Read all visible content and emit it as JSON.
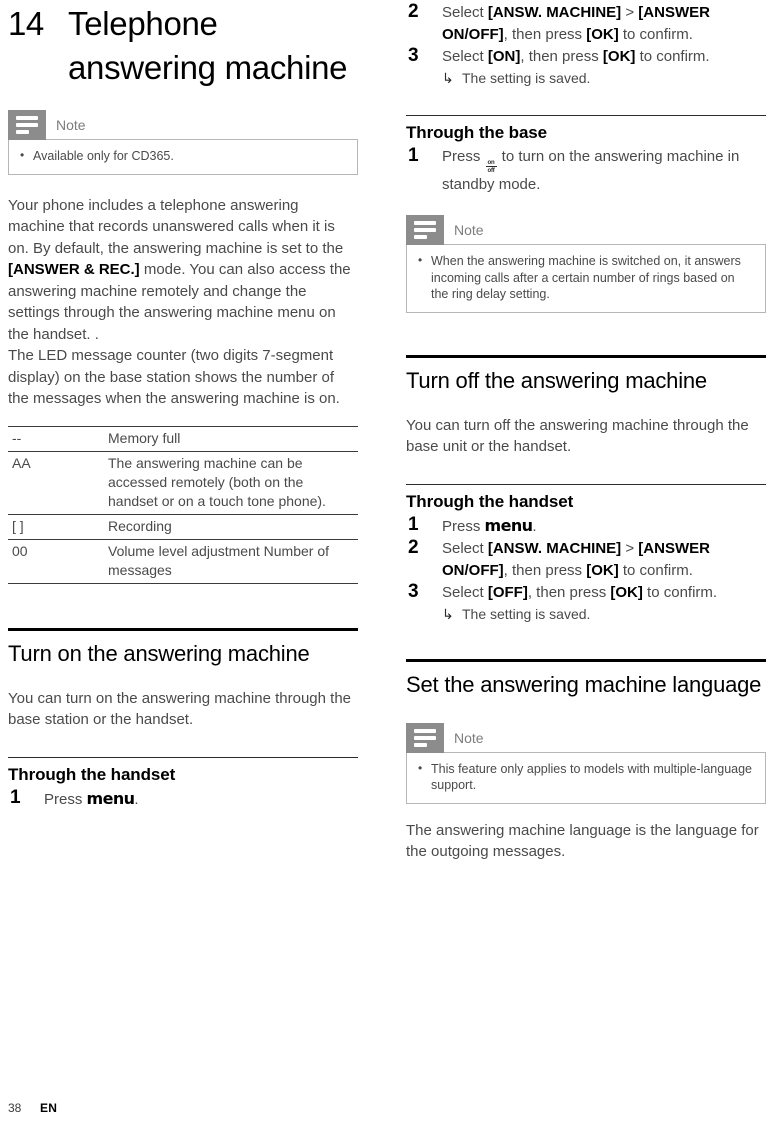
{
  "chapter": {
    "number": "14",
    "title": "Telephone answering machine"
  },
  "footer": {
    "page_number": "38",
    "language_code": "EN"
  },
  "icons": {
    "note_icon": "note-lines-icon",
    "onoff_top": "on",
    "onoff_bottom": "off",
    "substep_arrow": "↳"
  },
  "left_column": {
    "note_1": {
      "label": "Note",
      "items": [
        "Available only for CD365."
      ]
    },
    "intro_paragraphs": [
      "Your phone includes a telephone answering machine that records unanswered calls when it is on. By default, the answering machine is set to the",
      "[ANSWER & REC.] mode. You can also access the answering machine remotely and change the settings through the answering machine menu on the handset. .",
      "The LED message counter (two digits 7-segment display) on the base station shows the number of the messages when the answering machine is on."
    ],
    "intro_bold_run": "[ANSWER & REC.]",
    "intro_bold_tail": " mode. You can also access the answering machine remotely and change the settings through the answering machine menu on the handset. .",
    "table": {
      "rows": [
        {
          "code": "--",
          "description": "Memory full"
        },
        {
          "code": "AA",
          "description": "The answering machine can be accessed remotely (both on the handset or on a touch tone phone)."
        },
        {
          "code": "[ ]",
          "description": "Recording"
        },
        {
          "code": "00",
          "description": "Volume level adjustment Number of messages"
        }
      ]
    },
    "section_turn_on": {
      "heading": "Turn on the answering machine",
      "body": "You can turn on the answering machine through the base station or the handset.",
      "subsection": {
        "heading": "Through the handset",
        "steps": [
          {
            "num": "1",
            "text_before": "Press ",
            "key": "menu",
            "text_after": "."
          }
        ]
      }
    }
  },
  "right_column": {
    "continued_steps": [
      {
        "num": "2",
        "parts": [
          {
            "t": "Select ",
            "b": false
          },
          {
            "t": "[ANSW. MACHINE]",
            "b": true
          },
          {
            "t": " > ",
            "b": false
          },
          {
            "t": "[ANSWER ON/OFF]",
            "b": true
          },
          {
            "t": ", then press ",
            "b": false
          },
          {
            "t": "[OK]",
            "b": true
          },
          {
            "t": " to confirm.",
            "b": false
          }
        ]
      },
      {
        "num": "3",
        "parts": [
          {
            "t": "Select ",
            "b": false
          },
          {
            "t": "[ON]",
            "b": true
          },
          {
            "t": ", then press ",
            "b": false
          },
          {
            "t": "[OK]",
            "b": true
          },
          {
            "t": " to confirm.",
            "b": false
          }
        ],
        "substep": "The setting is saved."
      }
    ],
    "section_through_base": {
      "heading": "Through the base",
      "step_num": "1",
      "step_before": "Press ",
      "step_after": " to turn on the answering machine in standby mode.",
      "note": {
        "label": "Note",
        "items": [
          "When the answering machine is switched on, it answers incoming calls after a certain number of rings based on the ring delay setting."
        ]
      }
    },
    "section_turn_off": {
      "heading": "Turn off the answering machine",
      "body": "You can turn off the answering machine through the base unit or the handset.",
      "subsection": {
        "heading": "Through the handset",
        "steps": [
          {
            "num": "1",
            "parts": [
              {
                "t": "Press ",
                "b": false
              }
            ],
            "key": "menu",
            "tail": "."
          },
          {
            "num": "2",
            "parts": [
              {
                "t": "Select ",
                "b": false
              },
              {
                "t": "[ANSW. MACHINE]",
                "b": true
              },
              {
                "t": " > ",
                "b": false
              },
              {
                "t": "[ANSWER ON/OFF]",
                "b": true
              },
              {
                "t": ", then press ",
                "b": false
              },
              {
                "t": "[OK]",
                "b": true
              },
              {
                "t": " to confirm.",
                "b": false
              }
            ]
          },
          {
            "num": "3",
            "parts": [
              {
                "t": "Select ",
                "b": false
              },
              {
                "t": "[OFF]",
                "b": true
              },
              {
                "t": ", then press ",
                "b": false
              },
              {
                "t": "[OK]",
                "b": true
              },
              {
                "t": " to confirm.",
                "b": false
              }
            ],
            "substep": "The setting is saved."
          }
        ]
      }
    },
    "section_language": {
      "heading": "Set the answering machine language",
      "note": {
        "label": "Note",
        "items": [
          "This feature only applies to models with multiple-language support."
        ]
      },
      "body": "The answering machine language is the language for the outgoing messages."
    }
  },
  "colors": {
    "note_icon_bg": "#8c8c8c",
    "note_border": "#b6b6b6",
    "body_text": "#4a4a4a",
    "heading_text": "#000000"
  }
}
